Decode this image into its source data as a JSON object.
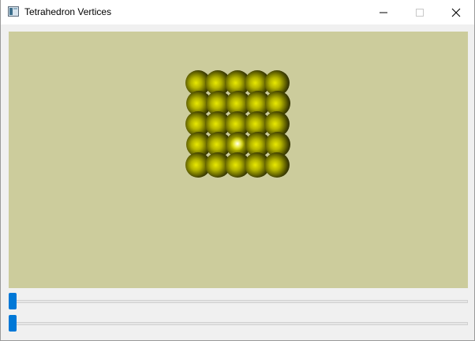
{
  "window": {
    "title": "Tetrahedron Vertices"
  },
  "titlebar": {
    "minimize_icon": "minimize-icon",
    "maximize_icon": "maximize-icon",
    "close_icon": "close-icon"
  },
  "viewport": {
    "background": "#cccc9c",
    "sphere_color": "#e8e800",
    "sphere_shadow": "#2a2a00",
    "grid_rows": 5,
    "grid_cols": 5
  },
  "sliders": [
    {
      "name": "slider-1",
      "value": 0.0,
      "accent": "#0078d7"
    },
    {
      "name": "slider-2",
      "value": 0.0,
      "accent": "#0078d7"
    }
  ]
}
